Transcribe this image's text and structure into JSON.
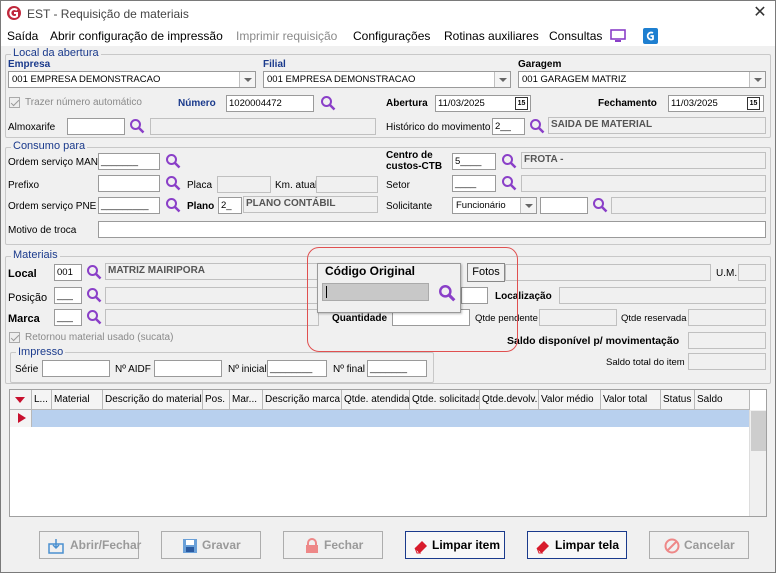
{
  "window": {
    "title": "EST - Requisição de materiais"
  },
  "menu": [
    "Saída",
    "Abrir configuração de impressão",
    "Imprimir requisição",
    "Configurações",
    "Rotinas auxiliares",
    "Consultas"
  ],
  "local_abertura": {
    "legend": "Local da abertura",
    "empresa_label": "Empresa",
    "empresa_value": "001 EMPRESA DEMONSTRACAO",
    "filial_label": "Filial",
    "filial_value": "001 EMPRESA DEMONSTRACAO",
    "garagem_label": "Garagem",
    "garagem_value": "001 GARAGEM MATRIZ",
    "trazer_label": "Trazer número automático",
    "numero_label": "Número",
    "numero_value": "1020004472",
    "abertura_label": "Abertura",
    "abertura_value": "11/03/2025",
    "fechamento_label": "Fechamento",
    "fechamento_value": "11/03/2025",
    "almoxarife_label": "Almoxarife",
    "historico_label": "Histórico do movimento",
    "historico_code": "2__",
    "historico_desc": "SAIDA DE MATERIAL"
  },
  "consumo": {
    "legend": "Consumo para",
    "ordem_man_label": "Ordem serviço MAN",
    "ordem_man_value": "_______",
    "prefixo_label": "Prefixo",
    "placa_label": "Placa",
    "km_label": "Km. atual",
    "ordem_pne_label": "Ordem serviço PNE",
    "ordem_pne_value": "_________",
    "plano_label": "Plano",
    "plano_code": "2_",
    "plano_desc": "PLANO CONTÁBIL",
    "motivo_label": "Motivo de troca",
    "centro_label_1": "Centro de",
    "centro_label_2": "custos-CTB",
    "centro_code": "5____",
    "centro_desc": "FROTA -",
    "setor_label": "Setor",
    "setor_value": "____",
    "solicitante_label": "Solicitante",
    "solicitante_type": "Funcionário"
  },
  "materiais": {
    "legend": "Materiais",
    "local_label": "Local",
    "local_code": "001",
    "local_desc": "MATRIZ MAIRIPORA",
    "posicao_label": "Posição",
    "posicao_value": "___",
    "marca_label": "Marca",
    "marca_value": "___",
    "quantidade_label": "Quantidade",
    "retornou_label": "Retornou material usado (sucata)",
    "fotos_label": "Fotos",
    "um_label": "U.M.",
    "localizacao_label": "Localização",
    "qtde_pendente_label": "Qtde pendente",
    "qtde_reservada_label": "Qtde reservada",
    "saldo_disp_label": "Saldo disponível p/ movimentação",
    "saldo_total_label": "Saldo total do item"
  },
  "impresso": {
    "legend": "Impresso",
    "serie_label": "Série",
    "aidf_label": "Nº AIDF",
    "inicial_label": "Nº inicial",
    "inicial_value": "________",
    "final_label": "Nº final",
    "final_value": "_______"
  },
  "popup": {
    "title": "Código Original"
  },
  "grid": {
    "columns": [
      "L...",
      "Material",
      "Descrição do material",
      "Pos.",
      "Mar...",
      "Descrição marca",
      "Qtde. atendida",
      "Qtde. solicitada",
      "Qtde.devolv.",
      "Valor médio",
      "Valor total",
      "Status",
      "Saldo"
    ]
  },
  "buttons": {
    "abrir": "Abrir/Fechar",
    "gravar": "Gravar",
    "fechar": "Fechar",
    "limpar_item": "Limpar item",
    "limpar_tela": "Limpar tela",
    "cancelar": "Cancelar"
  },
  "colors": {
    "accent": "#1a3a8c",
    "magnifier": "#8a3fc8",
    "highlight_ring": "#e05050",
    "selected_row": "#b8d0ee"
  }
}
